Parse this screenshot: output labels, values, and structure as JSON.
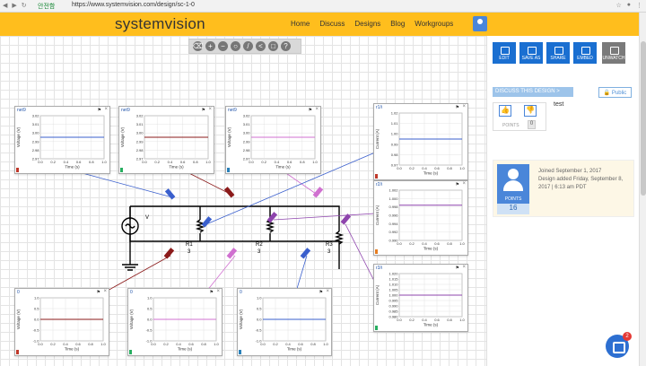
{
  "browser": {
    "secure_label": "안전함",
    "url": "https://www.systemvision.com/design/sc-1-0"
  },
  "site": {
    "logo": "systemvision",
    "nav": [
      "Home",
      "Discuss",
      "Designs",
      "Blog",
      "Workgroups"
    ]
  },
  "actions": [
    "EDIT",
    "SAVE AS",
    "SHARE",
    "EMBED",
    "UNWATCH"
  ],
  "discuss_label": "DISCUSS THIS DESIGN >",
  "public_label": "Public",
  "votes": {
    "points_label": "POINTS",
    "points": "0"
  },
  "description": "test",
  "profile": {
    "points_label": "POINTS",
    "points": "16",
    "joined": "Joined September 1, 2017",
    "added": "Design added Friday, September 8, 2017 | 6:13 am PDT"
  },
  "chat_badge": "2",
  "schematic": {
    "source_label": "V",
    "resistors": [
      {
        "name": "R1",
        "value": "3"
      },
      {
        "name": "R2",
        "value": "3"
      },
      {
        "name": "R3",
        "value": "3"
      }
    ]
  },
  "waveforms": [
    {
      "id": "p1",
      "title": "net9",
      "ylabel": "Voltage (V)",
      "xlabel": "Time (s)",
      "yticks": [
        "3.02",
        "3.01",
        "3.00",
        "2.99",
        "2.98",
        "2.97"
      ],
      "xticks": [
        "0.0",
        "0.2",
        "0.4",
        "0.6",
        "0.8",
        "1.0"
      ],
      "color": "#3a5fcd",
      "probe": "#c0392b",
      "level": 0.5
    },
    {
      "id": "p2",
      "title": "net9",
      "ylabel": "Voltage (V)",
      "xlabel": "Time (s)",
      "yticks": [
        "3.02",
        "3.01",
        "3.00",
        "2.99",
        "2.98",
        "2.97"
      ],
      "xticks": [
        "0.0",
        "0.2",
        "0.4",
        "0.6",
        "0.8",
        "1.0"
      ],
      "color": "#8b1a1a",
      "probe": "#27ae60",
      "level": 0.5
    },
    {
      "id": "p3",
      "title": "net9",
      "ylabel": "Voltage (V)",
      "xlabel": "Time (s)",
      "yticks": [
        "3.02",
        "3.01",
        "3.00",
        "2.99",
        "2.98",
        "2.97"
      ],
      "xticks": [
        "0.0",
        "0.2",
        "0.4",
        "0.6",
        "0.8",
        "1.0"
      ],
      "color": "#d070d0",
      "probe": "#2980b9",
      "level": 0.5
    },
    {
      "id": "p4",
      "title": "r1/i",
      "ylabel": "Current (A)",
      "xlabel": "Time (s)",
      "yticks": [
        "1.02",
        "1.01",
        "1.00",
        "0.99",
        "0.98",
        "0.97"
      ],
      "xticks": [
        "0.0",
        "0.2",
        "0.4",
        "0.6",
        "0.8",
        "1.0"
      ],
      "color": "#3a5fcd",
      "probe": "#c0392b",
      "level": 0.5
    },
    {
      "id": "p5",
      "title": "r2/i",
      "ylabel": "Current (A)",
      "xlabel": "Time (s)",
      "yticks": [
        "1.002",
        "1.000",
        "0.998",
        "0.996",
        "0.994",
        "0.992",
        "0.990"
      ],
      "xticks": [
        "0.0",
        "0.2",
        "0.4",
        "0.6",
        "0.8",
        "1.0"
      ],
      "color": "#8e44ad",
      "probe": "#e67e22",
      "level": 0.3
    },
    {
      "id": "p6",
      "title": "r3/i",
      "ylabel": "Current (A)",
      "xlabel": "Time (s)",
      "yticks": [
        "1.020",
        "1.015",
        "1.010",
        "1.005",
        "1.000",
        "0.995",
        "0.990",
        "0.985",
        "0.980"
      ],
      "xticks": [
        "0.0",
        "0.2",
        "0.4",
        "0.6",
        "0.8",
        "1.0"
      ],
      "color": "#8e44ad",
      "probe": "#27ae60",
      "level": 0.5
    },
    {
      "id": "p7",
      "title": "0",
      "ylabel": "Voltage (V)",
      "xlabel": "Time (s)",
      "yticks": [
        "1.0",
        "0.5",
        "0.0",
        "-0.5",
        "-1.0"
      ],
      "xticks": [
        "0.0",
        "0.2",
        "0.4",
        "0.6",
        "0.8",
        "1.0"
      ],
      "color": "#8b1a1a",
      "probe": "#c0392b",
      "level": 0.5
    },
    {
      "id": "p8",
      "title": "0",
      "ylabel": "Voltage (V)",
      "xlabel": "Time (s)",
      "yticks": [
        "1.0",
        "0.5",
        "0.0",
        "-0.5",
        "-1.0"
      ],
      "xticks": [
        "0.0",
        "0.2",
        "0.4",
        "0.6",
        "0.8",
        "1.0"
      ],
      "color": "#d070d0",
      "probe": "#27ae60",
      "level": 0.5
    },
    {
      "id": "p9",
      "title": "0",
      "ylabel": "Voltage (V)",
      "xlabel": "Time (s)",
      "yticks": [
        "1.0",
        "0.5",
        "0.0",
        "-0.5",
        "-1.0"
      ],
      "xticks": [
        "0.0",
        "0.2",
        "0.4",
        "0.6",
        "0.8",
        "1.0"
      ],
      "color": "#3a5fcd",
      "probe": "#2980b9",
      "level": 0.5
    }
  ]
}
